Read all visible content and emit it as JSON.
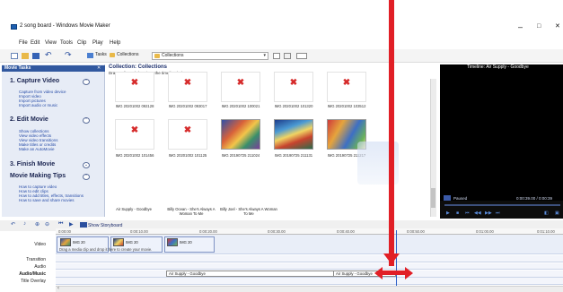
{
  "window": {
    "title": "2 song board - Windows Movie Maker",
    "minimize": "–",
    "maximize": "□",
    "close": "✕"
  },
  "menu": [
    "File",
    "Edit",
    "View",
    "Tools",
    "Clip",
    "Play",
    "Help"
  ],
  "toolbar": {
    "tasks_label": "Tasks",
    "collections_label": "Collections",
    "collection_select": "Collections"
  },
  "tasks": {
    "header": "Movie Tasks",
    "sections": [
      {
        "title": "1. Capture Video",
        "links": [
          "Capture from video device",
          "Import video",
          "Import pictures",
          "Import audio or music"
        ]
      },
      {
        "title": "2. Edit Movie",
        "links": [
          "Show collections",
          "View video effects",
          "View video transitions",
          "Make titles or credits",
          "Make an AutoMovie"
        ]
      },
      {
        "title": "3. Finish Movie",
        "links": []
      },
      {
        "title": "Movie Making Tips",
        "links": [
          "How to capture video",
          "How to edit clips",
          "How to add titles, effects, transitions",
          "How to save and share movies"
        ]
      }
    ]
  },
  "collection": {
    "title": "Collection: Collections",
    "subtitle": "Drag a clip and drop it on the timeline below.",
    "items": [
      {
        "label": "IMG 20201002 092128",
        "broken": true
      },
      {
        "label": "IMG 20201002 093017",
        "broken": true
      },
      {
        "label": "IMG 20201002 100021",
        "broken": true
      },
      {
        "label": "IMG 20201002 101320",
        "broken": true
      },
      {
        "label": "IMG 20201002 103512",
        "broken": true
      },
      {
        "label": "IMG 20201002 101456",
        "broken": true
      },
      {
        "label": "IMG 20201002 101125",
        "broken": true
      },
      {
        "label": "IMG 20190725 211024",
        "broken": false
      },
      {
        "label": "IMG 20190725 211131",
        "broken": false
      },
      {
        "label": "IMG 20190725 211217",
        "broken": false
      }
    ],
    "audio_items": [
      {
        "label": "Air Supply - Goodbye"
      },
      {
        "label": "Billy Ocean - She's Always A Woman To Me"
      },
      {
        "label": "Billy Joel - She's Always A Woman To Me"
      }
    ]
  },
  "preview": {
    "title": "Timeline: Air Supply - Goodbye",
    "status": "Paused",
    "timecode": "0:00:39.00 / 0:00:39"
  },
  "timeline": {
    "show_storyboard": "Show Storyboard",
    "ruler_ticks": [
      "0:00:00",
      "0:00:10.00",
      "0:00:20.00",
      "0:00:30.00",
      "0:00:40.00",
      "0:00:50.00",
      "0:01:00.00",
      "0:01:10.00"
    ],
    "tracks": [
      "Video",
      "Transition",
      "Audio",
      "Audio/Music",
      "Title Overlay"
    ],
    "video_clips": [
      "IMG 20",
      "IMG 20",
      "IMG 20"
    ],
    "video_hint": "Drag a media clip and drop it here to create your movie.",
    "audio_clips": [
      "Air Supply - Goodbye",
      "Air Supply - Goodbye"
    ]
  },
  "colors": {
    "annotation_arrow": "#e11f26",
    "task_header": "#31589f",
    "playhead": "#2b5fc7"
  }
}
